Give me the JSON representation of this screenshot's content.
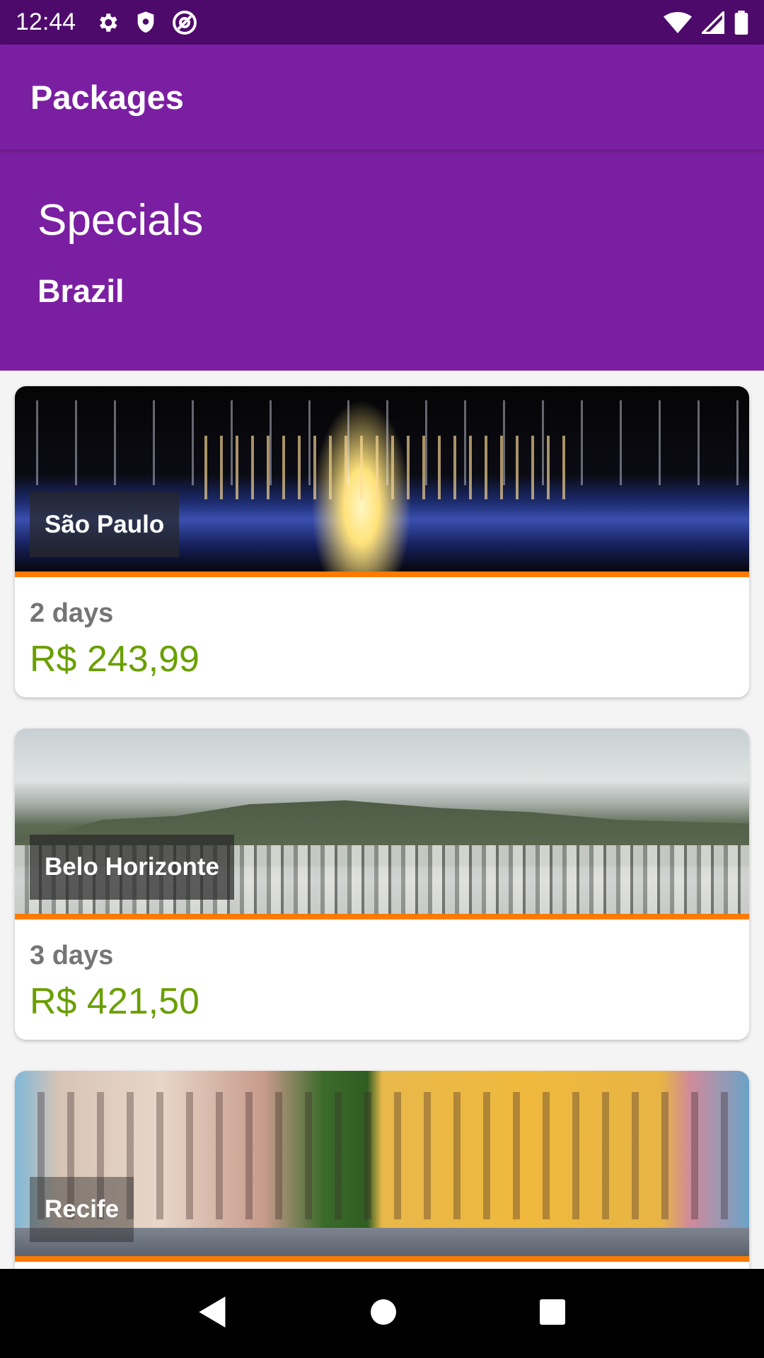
{
  "status_bar": {
    "time": "12:44",
    "icons_left": [
      "gear-icon",
      "shield-icon",
      "at-sign-icon"
    ],
    "icons_right": [
      "wifi-icon",
      "signal-icon",
      "battery-icon"
    ]
  },
  "app_bar": {
    "title": "Packages"
  },
  "header": {
    "title": "Specials",
    "subtitle": "Brazil"
  },
  "packages": [
    {
      "city": "São Paulo",
      "days": "2 days",
      "price": "R$  243,99"
    },
    {
      "city": "Belo Horizonte",
      "days": "3 days",
      "price": "R$  421,50"
    },
    {
      "city": "Recife",
      "days": "",
      "price": ""
    }
  ],
  "colors": {
    "status_bar": "#4d0a6b",
    "primary": "#7b1fa2",
    "accent": "#ff7a00",
    "price": "#6a9f00",
    "days": "#757575"
  },
  "nav_bar": {
    "buttons": [
      "back-icon",
      "home-icon",
      "recents-icon"
    ]
  }
}
